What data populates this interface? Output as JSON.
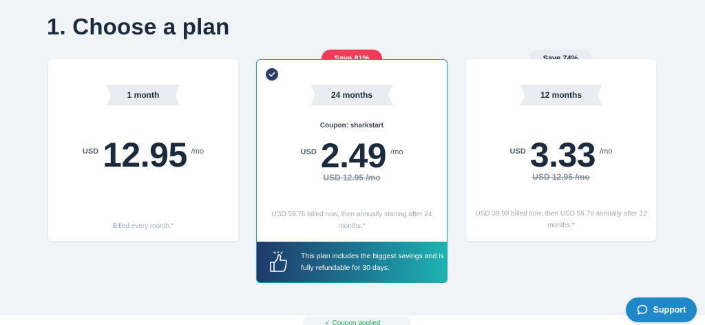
{
  "page": {
    "title": "1. Choose a plan"
  },
  "plans": [
    {
      "duration": "1 month",
      "currency": "USD",
      "price": "12.95",
      "per": "/mo",
      "billing": "Billed every month.*"
    },
    {
      "duration": "24 months",
      "save_badge": "Save 81%",
      "coupon": "Coupon: sharkstart",
      "currency": "USD",
      "price": "2.49",
      "per": "/mo",
      "old_price": "USD 12.95 /mo",
      "billing": "USD 59.76 billed now, then annually starting after 24 months.*",
      "selected": true,
      "promo": "This plan includes the biggest savings and is fully refundable for 30 days."
    },
    {
      "duration": "12 months",
      "save_badge": "Save 74%",
      "currency": "USD",
      "price": "3.33",
      "per": "/mo",
      "old_price": "USD 12.95 /mo",
      "billing": "USD 39.99 billed now, then USD 59.76 annually after 12 months.*"
    }
  ],
  "bottom": {
    "coupon_status": "✓ Coupon applied"
  },
  "support": {
    "label": "Support"
  },
  "icons": {
    "selected": "check-icon",
    "promo": "thumbs-up-icon",
    "support": "chat-bubble-icon"
  },
  "colors": {
    "accent_teal": "#1fa8a8",
    "save_red": "#f03c5a",
    "support_blue": "#1e88c9",
    "navy": "#1b2a3c"
  }
}
